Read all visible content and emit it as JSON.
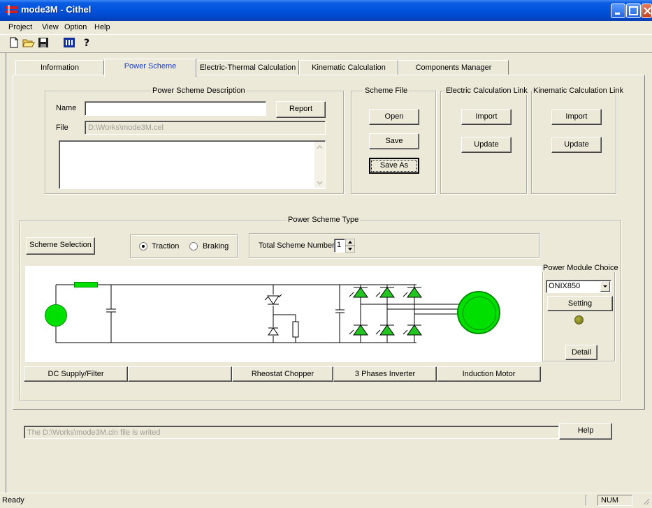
{
  "window": {
    "title": "mode3M - Cithel"
  },
  "menu": [
    "Project",
    "View",
    "Option",
    "Help"
  ],
  "toolbar_icons": [
    "new-file-icon",
    "open-folder-icon",
    "save-disk-icon",
    "cithel-icon",
    "help-icon"
  ],
  "tabs": [
    {
      "label": "Information"
    },
    {
      "label": "Power Scheme"
    },
    {
      "label": "Electric-Thermal Calculation"
    },
    {
      "label": "Kinematic Calculation"
    },
    {
      "label": "Components Manager"
    }
  ],
  "description": {
    "legend": "Power Scheme Description",
    "name_label": "Name",
    "name_value": "",
    "file_label": "File",
    "file_value": "D:\\Works\\mode3M.cel",
    "report_button": "Report",
    "notes": ""
  },
  "scheme_file": {
    "legend": "Scheme File",
    "open": "Open",
    "save": "Save",
    "save_as": "Save As"
  },
  "electric_link": {
    "legend": "Electric Calculation Link",
    "import": "Import",
    "update": "Update"
  },
  "kinematic_link": {
    "legend": "Kinematic Calculation Link",
    "import": "Import",
    "update": "Update"
  },
  "scheme_type": {
    "legend": "Power Scheme Type",
    "scheme_selection": "Scheme Selection",
    "traction": "Traction",
    "braking": "Braking",
    "total_label": "Total Scheme Number",
    "total_value": "1"
  },
  "power_module": {
    "legend": "Power Module Choice",
    "selected": "ONIX850",
    "setting": "Setting",
    "detail": "Detail"
  },
  "block_buttons": [
    "DC Supply/Filter",
    "",
    "Rheostat Chopper",
    "3 Phases Inverter",
    "Induction Motor"
  ],
  "message": "The D:\\Works\\mode3M.cin  file is writed",
  "help_button": "Help",
  "status": {
    "text": "Ready",
    "num": "NUM"
  },
  "colors": {
    "component_green": "#00E000",
    "titlebar_blue": "#0153DB"
  }
}
